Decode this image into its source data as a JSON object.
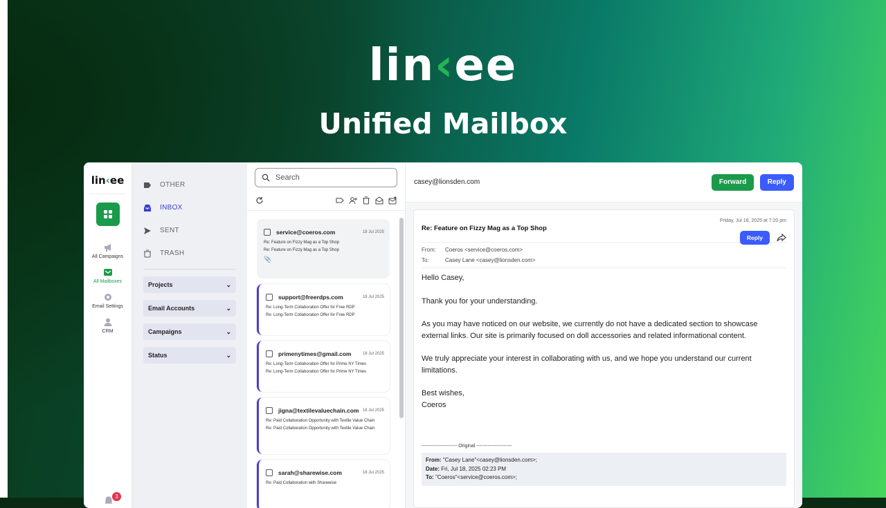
{
  "hero": {
    "logo_pre": "lin",
    "logo_acc": "‹",
    "logo_post": "ee",
    "title": "Unified Mailbox"
  },
  "rail": {
    "logo_pre": "lin",
    "logo_acc": "‹",
    "logo_post": "ee",
    "items": [
      {
        "label": "All Campaigns"
      },
      {
        "label": "All Mailboxes"
      },
      {
        "label": "Email Settings"
      },
      {
        "label": "CRM"
      }
    ],
    "notifications": "3"
  },
  "folders": {
    "items": [
      {
        "label": "OTHER"
      },
      {
        "label": "INBOX"
      },
      {
        "label": "SENT"
      },
      {
        "label": "TRASH"
      }
    ],
    "groups": [
      {
        "label": "Projects"
      },
      {
        "label": "Email Accounts"
      },
      {
        "label": "Campaigns"
      },
      {
        "label": "Status"
      }
    ]
  },
  "list": {
    "search_placeholder": "Search",
    "messages": [
      {
        "from": "service@coeros.com",
        "date": "18 Jul 2025",
        "line1": "Re: Feature on Fizzy Mag as a Top Shop",
        "line2": "Re: Feature on Fizzy Mag as a Top Shop"
      },
      {
        "from": "support@freerdps.com",
        "date": "18 Jul 2025",
        "line1": "Re: Long-Term Collaboration Offer for Free RDP",
        "line2": "Re: Long-Term Collaboration Offer for Free RDP"
      },
      {
        "from": "primenytimes@gmail.com",
        "date": "18 Jul 2025",
        "line1": "Re: Long-Term Collaboration Offer for Prime NY Times",
        "line2": "Re: Long-Term Collaboration Offer for Prime NY Times"
      },
      {
        "from": "jigna@textilevaluechain.com",
        "date": "18 Jul 2025",
        "line1": "Re: Paid Collaboration Opportunity with Textile Value Chain",
        "line2": "Re: Paid Collaboration Opportunity with Textile Value Chain"
      },
      {
        "from": "sarah@sharewise.com",
        "date": "18 Jul 2025",
        "line1": "Re: Paid Collaboration with Sharewise",
        "line2": ""
      }
    ]
  },
  "reader": {
    "account": "casey@lionsden.com",
    "forward_label": "Forward",
    "reply_label": "Reply",
    "date": "Friday, Jul 18, 2025 at 7:20 pm",
    "subject": "Re: Feature on Fizzy Mag as a Top Shop",
    "reply_small": "Reply",
    "from_label": "From:",
    "from": "Coeros <service@coeros.com>",
    "to_label": "To:",
    "to": "Casey Lane <casey@lionsden.com>",
    "body": [
      "Hello Casey,",
      "Thank you for your understanding.",
      "As you may have noticed on our website, we currently do not have a dedicated section to showcase external links. Our site is primarily focused on doll accessories and related informational content.",
      "We truly appreciate your interest in collaborating with us, and we hope you understand our current limitations.",
      "Best wishes,"
    ],
    "signature": "Coeros",
    "original_marker": "---------------------- Original ----------------------",
    "orig_from_label": "From:",
    "orig_from": "\"Casey Lane\"<casey@lionsden.com>;",
    "orig_date_label": "Date:",
    "orig_date": "Fri, Jul 18, 2025 02:23 PM",
    "orig_to_label": "To:",
    "orig_to": "\"Coeros\"<service@coeros.com>;"
  }
}
